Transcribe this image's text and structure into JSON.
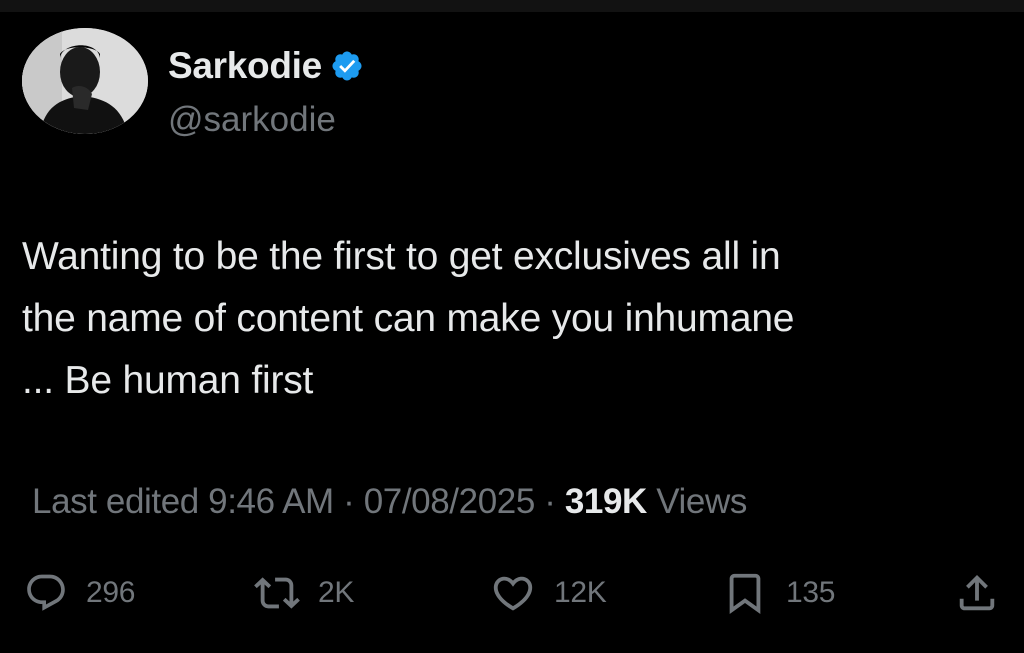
{
  "author": {
    "display_name": "Sarkodie",
    "handle": "@sarkodie",
    "verified": true,
    "verified_color": "#1d9bf0",
    "avatar": "profile-photo"
  },
  "tweet": {
    "text": "Wanting to be the first to get exclusives all in\nthe name of content can make you inhumane\n... Be human first"
  },
  "meta": {
    "edited_label": "Last edited",
    "time": "9:46 AM",
    "separator": "·",
    "date": "07/08/2025",
    "views_count": "319K",
    "views_label": "Views"
  },
  "actions": {
    "reply": {
      "icon": "reply-icon",
      "count": "296"
    },
    "repost": {
      "icon": "repost-icon",
      "count": "2K"
    },
    "like": {
      "icon": "heart-icon",
      "count": "12K"
    },
    "bookmark": {
      "icon": "bookmark-icon",
      "count": "135"
    },
    "share": {
      "icon": "share-icon"
    }
  },
  "colors": {
    "background": "#000000",
    "primary_text": "#e7e9ea",
    "secondary_text": "#71767b"
  }
}
